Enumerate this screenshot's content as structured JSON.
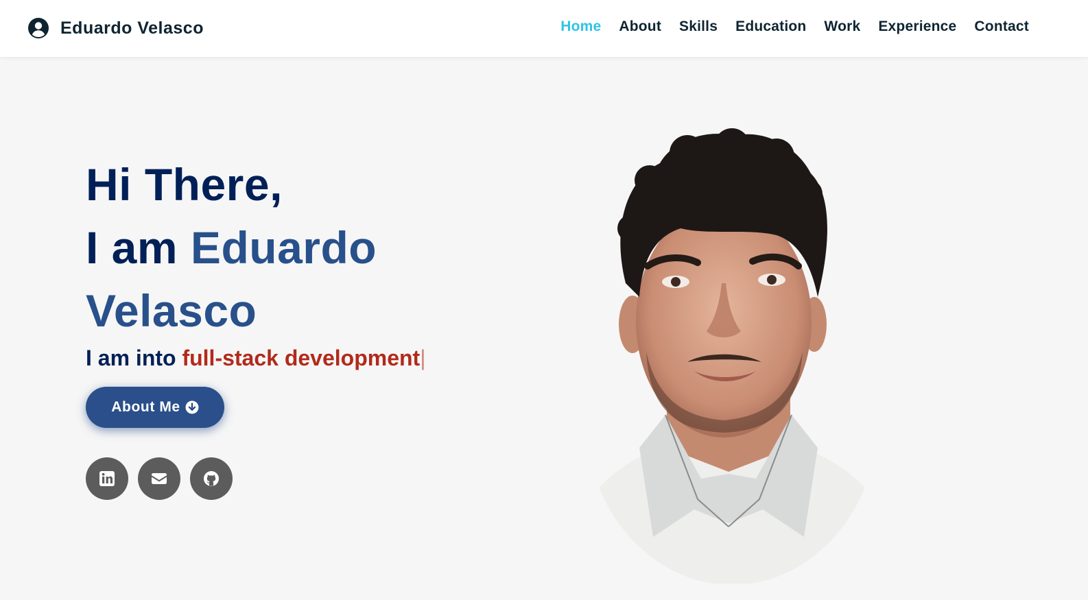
{
  "brand": {
    "name": "Eduardo Velasco",
    "icon": "user-circle-icon"
  },
  "nav": {
    "items": [
      {
        "label": "Home",
        "active": true
      },
      {
        "label": "About",
        "active": false
      },
      {
        "label": "Skills",
        "active": false
      },
      {
        "label": "Education",
        "active": false
      },
      {
        "label": "Work",
        "active": false
      },
      {
        "label": "Experience",
        "active": false
      },
      {
        "label": "Contact",
        "active": false
      }
    ]
  },
  "hero": {
    "greeting": "Hi There,",
    "intro": "I am",
    "first_name": "Eduardo",
    "last_name": "Velasco",
    "typed_prefix": "I am into",
    "typed_text": "full-stack development",
    "cursor": "|",
    "cta_label": "About Me",
    "cta_icon": "arrow-circle-down-icon"
  },
  "socials": [
    {
      "icon": "linkedin-icon"
    },
    {
      "icon": "envelope-icon"
    },
    {
      "icon": "github-icon"
    }
  ],
  "colors": {
    "navy": "#002057",
    "accent_blue": "#28508b",
    "nav_active": "#2ec4e6",
    "typed_red": "#b22a1b",
    "button_bg": "#2a4f8a",
    "social_bg": "#5c5c5c",
    "page_bg": "#f6f6f6"
  }
}
